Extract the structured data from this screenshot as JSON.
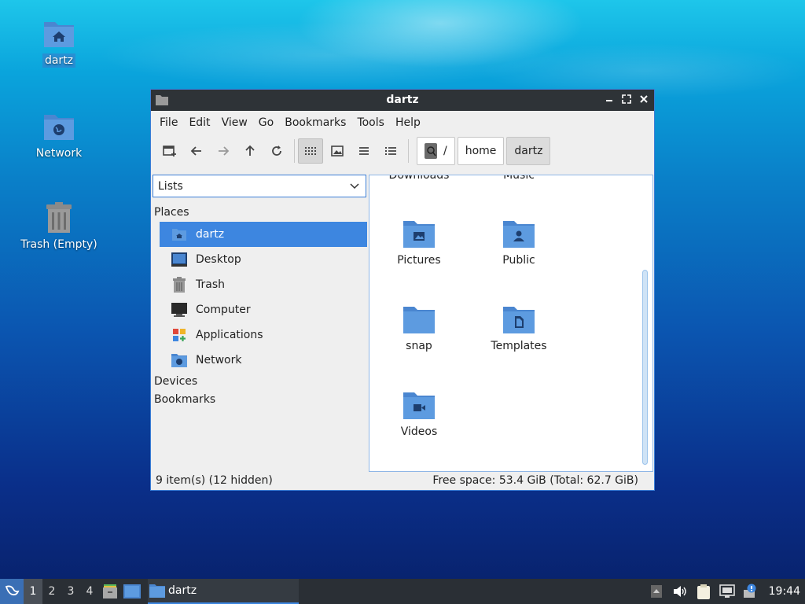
{
  "desktop": {
    "icons": [
      {
        "label": "dartz",
        "icon": "home-folder-icon"
      },
      {
        "label": "Network",
        "icon": "network-folder-icon"
      },
      {
        "label": "Trash (Empty)",
        "icon": "trash-icon"
      }
    ]
  },
  "window": {
    "title": "dartz",
    "menu": [
      "File",
      "Edit",
      "View",
      "Go",
      "Bookmarks",
      "Tools",
      "Help"
    ],
    "breadcrumbs": [
      "/",
      "home",
      "dartz"
    ],
    "side_pane_mode": "Lists",
    "sidebar": {
      "places_heading": "Places",
      "places": [
        {
          "label": "dartz",
          "icon": "home-folder-icon"
        },
        {
          "label": "Desktop",
          "icon": "desktop-icon"
        },
        {
          "label": "Trash",
          "icon": "trash-icon"
        },
        {
          "label": "Computer",
          "icon": "computer-icon"
        },
        {
          "label": "Applications",
          "icon": "applications-icon"
        },
        {
          "label": "Network",
          "icon": "network-icon"
        }
      ],
      "devices_heading": "Devices",
      "bookmarks_heading": "Bookmarks"
    },
    "files": [
      {
        "label": "Downloads"
      },
      {
        "label": "Music"
      },
      {
        "label": "Pictures",
        "icon": "pictures-folder-icon"
      },
      {
        "label": "Public",
        "icon": "public-folder-icon"
      },
      {
        "label": "snap",
        "icon": "folder-icon"
      },
      {
        "label": "Templates",
        "icon": "templates-folder-icon"
      },
      {
        "label": "Videos",
        "icon": "videos-folder-icon"
      }
    ],
    "status_left": "9 item(s) (12 hidden)",
    "status_right": "Free space: 53.4 GiB (Total: 62.7 GiB)"
  },
  "taskbar": {
    "workspaces": [
      "1",
      "2",
      "3",
      "4"
    ],
    "task_label": "dartz",
    "clock": "19:44"
  }
}
